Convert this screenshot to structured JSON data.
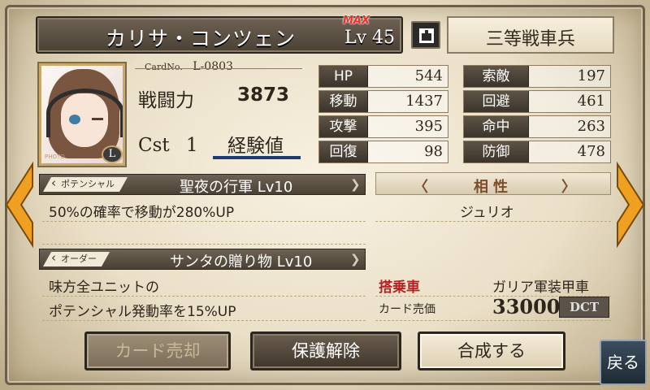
{
  "character": {
    "name": "カリサ・コンツェン",
    "max_badge": "MAX",
    "level": "Lv 45",
    "rank": "三等戦車兵"
  },
  "card": {
    "cardno_label": "CardNo.",
    "cardno_value": "L-0803",
    "power_label": "戦闘力",
    "power_value": "3873",
    "cst_label": "Cst",
    "cst_value": "1",
    "exp_label": "経験値",
    "portrait_badge": "L",
    "portrait_tag": "PHOTO"
  },
  "stats": [
    {
      "label": "HP",
      "value": "544"
    },
    {
      "label": "索敵",
      "value": "197"
    },
    {
      "label": "移動",
      "value": "1437"
    },
    {
      "label": "回避",
      "value": "461"
    },
    {
      "label": "攻撃",
      "value": "395"
    },
    {
      "label": "命中",
      "value": "263"
    },
    {
      "label": "回復",
      "value": "98"
    },
    {
      "label": "防御",
      "value": "478"
    }
  ],
  "potential": {
    "tag": "ポテンシャル",
    "title": "聖夜の行軍 Lv10",
    "desc1": "50%の確率で移動が280%UP"
  },
  "affinity": {
    "label": "相性",
    "partner": "ジュリオ"
  },
  "order": {
    "tag": "オーダー",
    "title": "サンタの贈り物 Lv10",
    "desc1": "味方全ユニットの",
    "desc2": "ポテンシャル発動率を15%UP"
  },
  "vehicle": {
    "label": "搭乗車",
    "value": "ガリア軍装甲車"
  },
  "sale": {
    "label": "カード売価",
    "price": "33000",
    "currency": "DCT"
  },
  "buttons": {
    "sell": "カード売却",
    "unprotect": "保護解除",
    "fuse": "合成する",
    "back": "戻る"
  },
  "colors": {
    "accent_orange": "#f0a020",
    "red_label": "#b62222"
  }
}
